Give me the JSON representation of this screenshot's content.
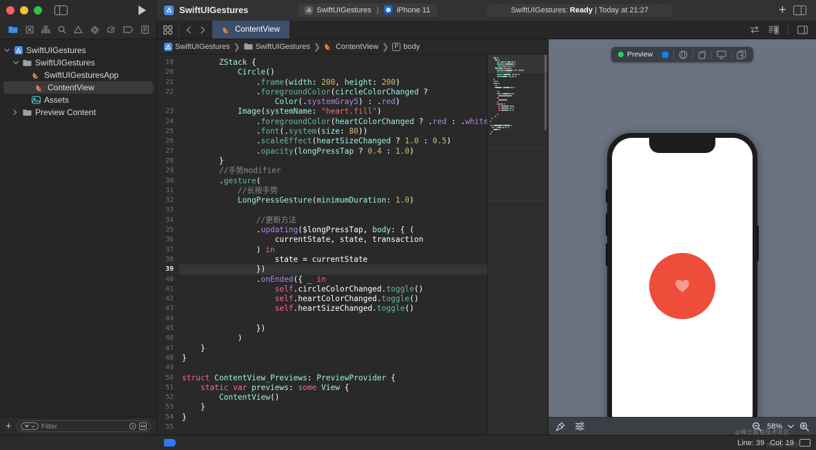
{
  "window": {
    "project_icon": "xcode-project-icon",
    "project_title": "SwiftUIGestures",
    "scheme_name": "SwiftUIGestures",
    "destination": "iPhone 11",
    "status_prefix": "SwiftUIGestures: ",
    "status_state": "Ready",
    "status_suffix": " | Today at 21:27",
    "add_label": "+",
    "run_icon": "play-icon",
    "sidebar_toggle_icon": "left-sidebar-toggle-icon",
    "inspector_toggle_icon": "right-sidebar-toggle-icon"
  },
  "navigator_toolbar": {
    "items": [
      {
        "name": "folder-icon",
        "label": "Project navigator",
        "active": true
      },
      {
        "name": "source-control-icon",
        "label": "Source control navigator",
        "active": false
      },
      {
        "name": "symbol-hierarchy-icon",
        "label": "Symbol navigator",
        "active": false
      },
      {
        "name": "search-icon",
        "label": "Find navigator",
        "active": false
      },
      {
        "name": "warning-triangle-icon",
        "label": "Issue navigator",
        "active": false
      },
      {
        "name": "test-diamond-icon",
        "label": "Test navigator",
        "active": false
      },
      {
        "name": "debug-gauge-icon",
        "label": "Debug navigator",
        "active": false
      },
      {
        "name": "breakpoint-tag-icon",
        "label": "Breakpoint navigator",
        "active": false
      },
      {
        "name": "report-log-icon",
        "label": "Report navigator",
        "active": false
      }
    ]
  },
  "navigator": {
    "tree": [
      {
        "indent": 0,
        "twisty": "v",
        "icon": "xcode-project-icon",
        "label": "SwiftUIGestures",
        "selected": false
      },
      {
        "indent": 1,
        "twisty": "v",
        "icon": "folder-icon",
        "label": "SwiftUIGestures",
        "selected": false
      },
      {
        "indent": 2,
        "twisty": "",
        "icon": "swift-file-icon",
        "label": "SwiftUIGesturesApp",
        "selected": false
      },
      {
        "indent": 2,
        "twisty": "",
        "icon": "swift-file-icon",
        "label": "ContentView",
        "selected": true
      },
      {
        "indent": 2,
        "twisty": "",
        "icon": "assets-icon",
        "label": "Assets",
        "selected": false
      },
      {
        "indent": 1,
        "twisty": ">",
        "icon": "folder-icon",
        "label": "Preview Content",
        "selected": false
      }
    ],
    "filter": {
      "placeholder": "Filter",
      "add_label": "+",
      "recent_icon": "clock-icon",
      "expand_icon": "expand-arrows-icon"
    }
  },
  "tabbar": {
    "grid_icon": "tab-grid-icon",
    "back_icon": "chevron-left-icon",
    "forward_icon": "chevron-right-icon",
    "tabs": [
      {
        "label": "ContentView",
        "icon": "swift-file-icon",
        "active": true
      }
    ],
    "right_icons": [
      {
        "name": "adjust-editor-icon"
      },
      {
        "name": "editor-options-icon"
      },
      {
        "name": "inspector-toggle-icon"
      }
    ]
  },
  "breadcrumb": {
    "items": [
      {
        "icon": "xcode-project-icon",
        "label": "SwiftUIGestures"
      },
      {
        "icon": "folder-icon",
        "label": "SwiftUIGestures"
      },
      {
        "icon": "swift-file-icon",
        "label": "ContentView"
      },
      {
        "icon": "property-badge-icon",
        "label": "body"
      }
    ]
  },
  "editor": {
    "first_line_number": 19,
    "current_line": 39,
    "lines": [
      {
        "n": 19,
        "tokens": [
          {
            "t": "        ",
            "c": "plain"
          },
          {
            "t": "ZStack",
            "c": "typ"
          },
          {
            "t": " {",
            "c": "plain"
          }
        ]
      },
      {
        "n": 20,
        "tokens": [
          {
            "t": "            ",
            "c": "plain"
          },
          {
            "t": "Circle",
            "c": "typ"
          },
          {
            "t": "()",
            "c": "plain"
          }
        ]
      },
      {
        "n": 21,
        "tokens": [
          {
            "t": "                .",
            "c": "plain"
          },
          {
            "t": "frame",
            "c": "mth"
          },
          {
            "t": "(",
            "c": "plain"
          },
          {
            "t": "width",
            "c": "var"
          },
          {
            "t": ": ",
            "c": "plain"
          },
          {
            "t": "200",
            "c": "num"
          },
          {
            "t": ", ",
            "c": "plain"
          },
          {
            "t": "height",
            "c": "var"
          },
          {
            "t": ": ",
            "c": "plain"
          },
          {
            "t": "200",
            "c": "num"
          },
          {
            "t": ")",
            "c": "plain"
          }
        ]
      },
      {
        "n": 22,
        "tokens": [
          {
            "t": "                .",
            "c": "plain"
          },
          {
            "t": "foregroundColor",
            "c": "mth"
          },
          {
            "t": "(",
            "c": "plain"
          },
          {
            "t": "circleColorChanged",
            "c": "var"
          },
          {
            "t": " ?",
            "c": "plain"
          }
        ]
      },
      {
        "n": null,
        "tokens": [
          {
            "t": "                    ",
            "c": "plain"
          },
          {
            "t": "Color",
            "c": "typ"
          },
          {
            "t": "(.",
            "c": "plain"
          },
          {
            "t": "systemGray5",
            "c": "prop"
          },
          {
            "t": ") : .",
            "c": "plain"
          },
          {
            "t": "red",
            "c": "prop"
          },
          {
            "t": ")",
            "c": "plain"
          }
        ]
      },
      {
        "n": 23,
        "tokens": [
          {
            "t": "            ",
            "c": "plain"
          },
          {
            "t": "Image",
            "c": "typ"
          },
          {
            "t": "(",
            "c": "plain"
          },
          {
            "t": "systemName",
            "c": "var"
          },
          {
            "t": ": ",
            "c": "plain"
          },
          {
            "t": "\"heart.fill\"",
            "c": "str"
          },
          {
            "t": ")",
            "c": "plain"
          }
        ]
      },
      {
        "n": 24,
        "tokens": [
          {
            "t": "                .",
            "c": "plain"
          },
          {
            "t": "foregroundColor",
            "c": "mth"
          },
          {
            "t": "(",
            "c": "plain"
          },
          {
            "t": "heartColorChanged",
            "c": "var"
          },
          {
            "t": " ? .",
            "c": "plain"
          },
          {
            "t": "red",
            "c": "prop"
          },
          {
            "t": " : .",
            "c": "plain"
          },
          {
            "t": "white",
            "c": "prop"
          },
          {
            "t": ")",
            "c": "plain"
          }
        ]
      },
      {
        "n": 25,
        "tokens": [
          {
            "t": "                .",
            "c": "plain"
          },
          {
            "t": "font",
            "c": "mth"
          },
          {
            "t": "(.",
            "c": "plain"
          },
          {
            "t": "system",
            "c": "mth"
          },
          {
            "t": "(",
            "c": "plain"
          },
          {
            "t": "size",
            "c": "var"
          },
          {
            "t": ": ",
            "c": "plain"
          },
          {
            "t": "80",
            "c": "num"
          },
          {
            "t": "))",
            "c": "plain"
          }
        ]
      },
      {
        "n": 26,
        "tokens": [
          {
            "t": "                .",
            "c": "plain"
          },
          {
            "t": "scaleEffect",
            "c": "mth"
          },
          {
            "t": "(",
            "c": "plain"
          },
          {
            "t": "heartSizeChanged",
            "c": "var"
          },
          {
            "t": " ? ",
            "c": "plain"
          },
          {
            "t": "1.0",
            "c": "num"
          },
          {
            "t": " : ",
            "c": "plain"
          },
          {
            "t": "0.5",
            "c": "num"
          },
          {
            "t": ")",
            "c": "plain"
          }
        ]
      },
      {
        "n": 27,
        "tokens": [
          {
            "t": "                .",
            "c": "plain"
          },
          {
            "t": "opacity",
            "c": "mth"
          },
          {
            "t": "(",
            "c": "plain"
          },
          {
            "t": "longPressTap",
            "c": "var"
          },
          {
            "t": " ? ",
            "c": "plain"
          },
          {
            "t": "0.4",
            "c": "num"
          },
          {
            "t": " : ",
            "c": "plain"
          },
          {
            "t": "1.0",
            "c": "num"
          },
          {
            "t": ")",
            "c": "plain"
          }
        ]
      },
      {
        "n": 28,
        "tokens": [
          {
            "t": "        }",
            "c": "plain"
          }
        ]
      },
      {
        "n": 29,
        "tokens": [
          {
            "t": "        //手势modifier",
            "c": "cmt"
          }
        ]
      },
      {
        "n": 30,
        "tokens": [
          {
            "t": "        .",
            "c": "plain"
          },
          {
            "t": "gesture",
            "c": "mth"
          },
          {
            "t": "(",
            "c": "plain"
          }
        ]
      },
      {
        "n": 31,
        "tokens": [
          {
            "t": "            //长按手势",
            "c": "cmt"
          }
        ]
      },
      {
        "n": 32,
        "tokens": [
          {
            "t": "            ",
            "c": "plain"
          },
          {
            "t": "LongPressGesture",
            "c": "typ"
          },
          {
            "t": "(",
            "c": "plain"
          },
          {
            "t": "minimumDuration",
            "c": "var"
          },
          {
            "t": ": ",
            "c": "plain"
          },
          {
            "t": "1.0",
            "c": "num"
          },
          {
            "t": ")",
            "c": "plain"
          }
        ]
      },
      {
        "n": 33,
        "tokens": [
          {
            "t": "",
            "c": "plain"
          }
        ]
      },
      {
        "n": 34,
        "tokens": [
          {
            "t": "                //更新方法",
            "c": "cmt"
          }
        ]
      },
      {
        "n": 35,
        "tokens": [
          {
            "t": "                .",
            "c": "plain"
          },
          {
            "t": "updating",
            "c": "meth2"
          },
          {
            "t": "($",
            "c": "plain"
          },
          {
            "t": "longPressTap",
            "c": "id"
          },
          {
            "t": ", ",
            "c": "plain"
          },
          {
            "t": "body",
            "c": "var"
          },
          {
            "t": ": { (",
            "c": "plain"
          }
        ]
      },
      {
        "n": 36,
        "tokens": [
          {
            "t": "                    currentState, state, transaction",
            "c": "plain"
          }
        ]
      },
      {
        "n": 37,
        "tokens": [
          {
            "t": "                ) ",
            "c": "plain"
          },
          {
            "t": "in",
            "c": "kw"
          }
        ]
      },
      {
        "n": 38,
        "tokens": [
          {
            "t": "                    state = currentState",
            "c": "plain"
          }
        ]
      },
      {
        "n": 39,
        "tokens": [
          {
            "t": "                })",
            "c": "plain"
          }
        ]
      },
      {
        "n": 40,
        "tokens": [
          {
            "t": "                .",
            "c": "plain"
          },
          {
            "t": "onEnded",
            "c": "meth2"
          },
          {
            "t": "({ _ ",
            "c": "plain"
          },
          {
            "t": "in",
            "c": "kw"
          }
        ]
      },
      {
        "n": 41,
        "tokens": [
          {
            "t": "                    ",
            "c": "plain"
          },
          {
            "t": "self",
            "c": "kw"
          },
          {
            "t": ".circleColorChanged.",
            "c": "plain"
          },
          {
            "t": "toggle",
            "c": "mth"
          },
          {
            "t": "()",
            "c": "plain"
          }
        ]
      },
      {
        "n": 42,
        "tokens": [
          {
            "t": "                    ",
            "c": "plain"
          },
          {
            "t": "self",
            "c": "kw"
          },
          {
            "t": ".heartColorChanged.",
            "c": "plain"
          },
          {
            "t": "toggle",
            "c": "mth"
          },
          {
            "t": "()",
            "c": "plain"
          }
        ]
      },
      {
        "n": 43,
        "tokens": [
          {
            "t": "                    ",
            "c": "plain"
          },
          {
            "t": "self",
            "c": "kw"
          },
          {
            "t": ".heartSizeChanged.",
            "c": "plain"
          },
          {
            "t": "toggle",
            "c": "mth"
          },
          {
            "t": "()",
            "c": "plain"
          }
        ]
      },
      {
        "n": 44,
        "tokens": [
          {
            "t": "",
            "c": "plain"
          }
        ]
      },
      {
        "n": 45,
        "tokens": [
          {
            "t": "                })",
            "c": "plain"
          }
        ]
      },
      {
        "n": 46,
        "tokens": [
          {
            "t": "            )",
            "c": "plain"
          }
        ]
      },
      {
        "n": 47,
        "tokens": [
          {
            "t": "    }",
            "c": "plain"
          }
        ]
      },
      {
        "n": 48,
        "tokens": [
          {
            "t": "}",
            "c": "plain"
          }
        ]
      },
      {
        "n": 49,
        "tokens": [
          {
            "t": "",
            "c": "plain"
          }
        ]
      },
      {
        "n": 50,
        "tokens": [
          {
            "t": "struct",
            "c": "kw"
          },
          {
            "t": " ",
            "c": "plain"
          },
          {
            "t": "ContentView_Previews",
            "c": "typ"
          },
          {
            "t": ": ",
            "c": "plain"
          },
          {
            "t": "PreviewProvider",
            "c": "typ"
          },
          {
            "t": " {",
            "c": "plain"
          }
        ]
      },
      {
        "n": 51,
        "tokens": [
          {
            "t": "    ",
            "c": "plain"
          },
          {
            "t": "static",
            "c": "kw"
          },
          {
            "t": " ",
            "c": "plain"
          },
          {
            "t": "var",
            "c": "kw"
          },
          {
            "t": " ",
            "c": "plain"
          },
          {
            "t": "previews",
            "c": "var"
          },
          {
            "t": ": ",
            "c": "plain"
          },
          {
            "t": "some",
            "c": "kw"
          },
          {
            "t": " ",
            "c": "plain"
          },
          {
            "t": "View",
            "c": "typ"
          },
          {
            "t": " {",
            "c": "plain"
          }
        ]
      },
      {
        "n": 52,
        "tokens": [
          {
            "t": "        ",
            "c": "plain"
          },
          {
            "t": "ContentView",
            "c": "typ"
          },
          {
            "t": "()",
            "c": "plain"
          }
        ]
      },
      {
        "n": 53,
        "tokens": [
          {
            "t": "    }",
            "c": "plain"
          }
        ]
      },
      {
        "n": 54,
        "tokens": [
          {
            "t": "}",
            "c": "plain"
          }
        ]
      },
      {
        "n": 55,
        "tokens": [
          {
            "t": "",
            "c": "plain"
          }
        ]
      }
    ]
  },
  "canvas": {
    "preview_toolbar": {
      "status_label": "Preview",
      "status_color": "#30d158",
      "live_icon": "live-preview-icon",
      "inspect_icon": "inspect-preview-icon",
      "device_settings_icon": "device-settings-icon",
      "display_icon": "display-variants-icon",
      "duplicate_icon": "duplicate-preview-icon"
    },
    "device_name": "iPhone 11",
    "preview": {
      "circle_color": "#ee4d3c",
      "heart_color": "#f79b8e",
      "background_color": "#ffffff"
    },
    "bottom": {
      "pin_icon": "pin-icon",
      "variants_icon": "variants-icon",
      "zoom_out_icon": "zoom-out-icon",
      "zoom_level": "58%",
      "zoom_menu_icon": "chevron-down-icon",
      "zoom_in_icon": "zoom-in-icon"
    }
  },
  "statusbar": {
    "breakpoint_icon": "breakpoint-tag-icon",
    "line_label": "Line: 39",
    "col_label": "Col: 19",
    "keyboard_icon": "keyboard-icon",
    "watermark": "@稀土掘金技术社区",
    "watermark_small": "掘金技术社区"
  }
}
